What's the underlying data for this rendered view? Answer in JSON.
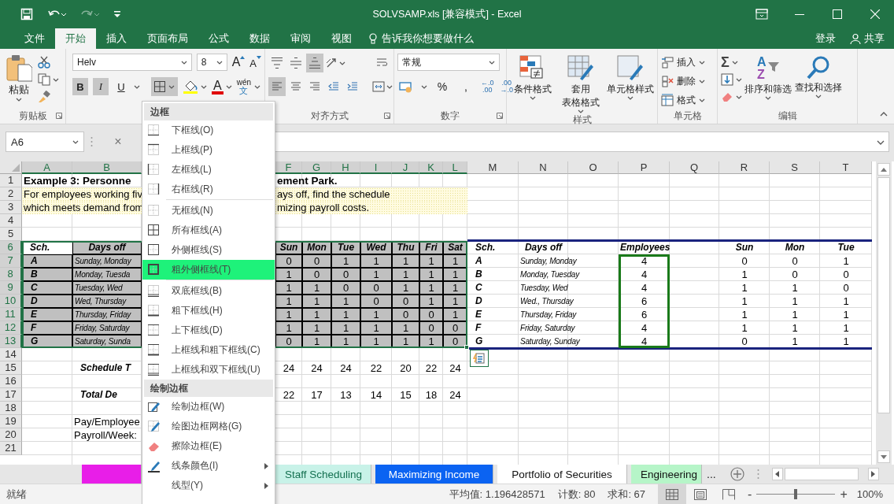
{
  "window": {
    "title": "SOLVSAMP.xls  [兼容模式] - Excel",
    "redo_disabled": true
  },
  "menu_tabs": [
    {
      "label": "文件",
      "selected": false
    },
    {
      "label": "开始",
      "selected": true
    },
    {
      "label": "插入",
      "selected": false
    },
    {
      "label": "页面布局",
      "selected": false
    },
    {
      "label": "公式",
      "selected": false
    },
    {
      "label": "数据",
      "selected": false
    },
    {
      "label": "审阅",
      "selected": false
    },
    {
      "label": "视图",
      "selected": false
    }
  ],
  "tell_me": "告诉我你想要做什么",
  "sign_in": "登录",
  "share": "共享",
  "ribbon": {
    "clipboard": {
      "paste": "粘贴",
      "label": "剪贴板"
    },
    "font": {
      "name": "Helv",
      "size": "8",
      "grow": "A",
      "shrink": "A",
      "buttons": [
        {
          "text": "B",
          "on": true
        },
        {
          "text": "I",
          "on": true
        },
        {
          "text": "U",
          "on": false
        }
      ],
      "borders_on": true,
      "font_color": "A",
      "phonetic": {
        "top": "wén",
        "bottom": "文"
      }
    },
    "alignment": {
      "label": "对齐方式",
      "top_row": [
        {
          "on": false
        },
        {
          "on": false
        },
        {
          "on": true
        },
        {
          "on": false
        }
      ],
      "bottom_row": [
        {
          "on": true
        },
        {
          "on": false
        },
        {
          "on": false
        },
        {
          "on": false
        },
        {
          "on": false
        }
      ]
    },
    "number": {
      "format": "常规",
      "percent": "%",
      "comma": ",",
      "more_decimals": {
        "top": "←.0",
        "bottom": ".00"
      },
      "fewer_decimals": {
        "top": ".00",
        "bottom": "→.0"
      },
      "label": "数字"
    },
    "styles": {
      "buttons": [
        {
          "lines": [
            "条件格式"
          ]
        },
        {
          "lines": [
            "套用",
            "表格格式"
          ]
        },
        {
          "lines": [
            "单元格样式"
          ]
        }
      ],
      "label": "样式"
    },
    "cells": {
      "buttons": [
        "插入",
        "删除",
        "格式"
      ],
      "label": "单元格"
    },
    "editing": {
      "sum": "Σ",
      "sort_letters": {
        "top": "A",
        "bottom": "Z"
      },
      "buttons": [
        "排序和筛选",
        "查找和选择"
      ],
      "label": "编辑"
    }
  },
  "formula_bar": {
    "name_box": "A6",
    "cancel": "×"
  },
  "sheet": {
    "columns": [
      {
        "letter": "A",
        "selected": true
      },
      {
        "letter": "B",
        "selected": true
      },
      {
        "letter": "F",
        "selected": true
      },
      {
        "letter": "G",
        "selected": true
      },
      {
        "letter": "H",
        "selected": true
      },
      {
        "letter": "I",
        "selected": true
      },
      {
        "letter": "J",
        "selected": true
      },
      {
        "letter": "K",
        "selected": true
      },
      {
        "letter": "L",
        "selected": true
      },
      {
        "letter": "M",
        "selected": false
      },
      {
        "letter": "N",
        "selected": false
      },
      {
        "letter": "O",
        "selected": false
      },
      {
        "letter": "P",
        "selected": false
      },
      {
        "letter": "Q",
        "selected": false
      },
      {
        "letter": "R",
        "selected": false
      },
      {
        "letter": "S",
        "selected": false
      },
      {
        "letter": "T",
        "selected": false
      }
    ],
    "rows": [
      {
        "number": "1",
        "selected": false,
        "highlighted": false,
        "cells": [
          {
            "text": "Example 3:  Personne",
            "kind": "title",
            "shaded": false
          },
          null,
          {
            "text": "ement Park.",
            "kind": "title",
            "shaded": false
          },
          null,
          null,
          null,
          null,
          null,
          null,
          null,
          null,
          null,
          null,
          null,
          null,
          null,
          null
        ]
      },
      {
        "number": "2",
        "selected": false,
        "highlighted": true,
        "cells": [
          {
            "text": "For employees working fiv",
            "kind": "text",
            "shaded": false
          },
          null,
          {
            "text": "ays off, find the schedule",
            "kind": "text",
            "shaded": false
          },
          null,
          null,
          null,
          null,
          null,
          null,
          null,
          null,
          null,
          null,
          null,
          null,
          null,
          null
        ]
      },
      {
        "number": "3",
        "selected": false,
        "highlighted": true,
        "cells": [
          {
            "text": "which meets demand from",
            "kind": "text",
            "shaded": false
          },
          null,
          {
            "text": "mizing payroll costs.",
            "kind": "text",
            "shaded": false
          },
          null,
          null,
          null,
          null,
          null,
          null,
          null,
          null,
          null,
          null,
          null,
          null,
          null,
          null
        ]
      },
      {
        "number": "4",
        "selected": false,
        "highlighted": false,
        "cells": []
      },
      {
        "number": "5",
        "selected": false,
        "highlighted": false,
        "cells": []
      },
      {
        "number": "6",
        "selected": true,
        "highlighted": false,
        "cells": [
          {
            "text": "Sch.",
            "kind": "letter",
            "shaded": false
          },
          {
            "text": "Days off",
            "kind": "head",
            "shaded": true
          },
          {
            "text": "Sun",
            "kind": "head",
            "shaded": true
          },
          {
            "text": "Mon",
            "kind": "head",
            "shaded": true
          },
          {
            "text": "Tue",
            "kind": "head",
            "shaded": true
          },
          {
            "text": "Wed",
            "kind": "head",
            "shaded": true
          },
          {
            "text": "Thu",
            "kind": "head",
            "shaded": true
          },
          {
            "text": "Fri",
            "kind": "head",
            "shaded": true
          },
          {
            "text": "Sat",
            "kind": "head",
            "shaded": true
          },
          {
            "text": "Sch.",
            "kind": "letter",
            "shaded": false
          },
          {
            "text": "Days off",
            "kind": "head",
            "shaded": false
          },
          null,
          {
            "text": "Employees",
            "kind": "head",
            "shaded": false
          },
          null,
          {
            "text": "Sun",
            "kind": "head",
            "shaded": false
          },
          {
            "text": "Mon",
            "kind": "head",
            "shaded": false
          },
          {
            "text": "Tue",
            "kind": "head",
            "shaded": false
          }
        ]
      },
      {
        "number": "7",
        "selected": true,
        "highlighted": false,
        "cells": [
          {
            "text": "A",
            "kind": "letter",
            "shaded": true
          },
          {
            "text": "Sunday, Monday",
            "kind": "days",
            "shaded": true
          },
          {
            "text": "0",
            "kind": "num",
            "shaded": true
          },
          {
            "text": "0",
            "kind": "num",
            "shaded": true
          },
          {
            "text": "1",
            "kind": "num",
            "shaded": true
          },
          {
            "text": "1",
            "kind": "num",
            "shaded": true
          },
          {
            "text": "1",
            "kind": "num",
            "shaded": true
          },
          {
            "text": "1",
            "kind": "num",
            "shaded": true
          },
          {
            "text": "1",
            "kind": "num",
            "shaded": true
          },
          {
            "text": "A",
            "kind": "letter",
            "shaded": false
          },
          {
            "text": "Sunday, Monday",
            "kind": "days",
            "shaded": false
          },
          null,
          {
            "text": "4",
            "kind": "num",
            "shaded": false
          },
          null,
          {
            "text": "0",
            "kind": "num",
            "shaded": false
          },
          {
            "text": "0",
            "kind": "num",
            "shaded": false
          },
          {
            "text": "1",
            "kind": "num",
            "shaded": false
          }
        ]
      },
      {
        "number": "8",
        "selected": true,
        "highlighted": false,
        "cells": [
          {
            "text": "B",
            "kind": "letter",
            "shaded": true
          },
          {
            "text": "Monday, Tuesda",
            "kind": "days",
            "shaded": true
          },
          {
            "text": "1",
            "kind": "num",
            "shaded": true
          },
          {
            "text": "0",
            "kind": "num",
            "shaded": true
          },
          {
            "text": "0",
            "kind": "num",
            "shaded": true
          },
          {
            "text": "1",
            "kind": "num",
            "shaded": true
          },
          {
            "text": "1",
            "kind": "num",
            "shaded": true
          },
          {
            "text": "1",
            "kind": "num",
            "shaded": true
          },
          {
            "text": "1",
            "kind": "num",
            "shaded": true
          },
          {
            "text": "B",
            "kind": "letter",
            "shaded": false
          },
          {
            "text": "Monday, Tuesday",
            "kind": "days",
            "shaded": false
          },
          null,
          {
            "text": "4",
            "kind": "num",
            "shaded": false
          },
          null,
          {
            "text": "1",
            "kind": "num",
            "shaded": false
          },
          {
            "text": "0",
            "kind": "num",
            "shaded": false
          },
          {
            "text": "0",
            "kind": "num",
            "shaded": false
          }
        ]
      },
      {
        "number": "9",
        "selected": true,
        "highlighted": false,
        "cells": [
          {
            "text": "C",
            "kind": "letter",
            "shaded": true
          },
          {
            "text": "Tuesday, Wed",
            "kind": "days",
            "shaded": true
          },
          {
            "text": "1",
            "kind": "num",
            "shaded": true
          },
          {
            "text": "1",
            "kind": "num",
            "shaded": true
          },
          {
            "text": "0",
            "kind": "num",
            "shaded": true
          },
          {
            "text": "0",
            "kind": "num",
            "shaded": true
          },
          {
            "text": "1",
            "kind": "num",
            "shaded": true
          },
          {
            "text": "1",
            "kind": "num",
            "shaded": true
          },
          {
            "text": "1",
            "kind": "num",
            "shaded": true
          },
          {
            "text": "C",
            "kind": "letter",
            "shaded": false
          },
          {
            "text": "Tuesday, Wed",
            "kind": "days",
            "shaded": false
          },
          null,
          {
            "text": "4",
            "kind": "num",
            "shaded": false
          },
          null,
          {
            "text": "1",
            "kind": "num",
            "shaded": false
          },
          {
            "text": "1",
            "kind": "num",
            "shaded": false
          },
          {
            "text": "0",
            "kind": "num",
            "shaded": false
          }
        ]
      },
      {
        "number": "10",
        "selected": true,
        "highlighted": false,
        "cells": [
          {
            "text": "D",
            "kind": "letter",
            "shaded": true
          },
          {
            "text": "Wed, Thursday",
            "kind": "days",
            "shaded": true
          },
          {
            "text": "1",
            "kind": "num",
            "shaded": true
          },
          {
            "text": "1",
            "kind": "num",
            "shaded": true
          },
          {
            "text": "1",
            "kind": "num",
            "shaded": true
          },
          {
            "text": "0",
            "kind": "num",
            "shaded": true
          },
          {
            "text": "0",
            "kind": "num",
            "shaded": true
          },
          {
            "text": "1",
            "kind": "num",
            "shaded": true
          },
          {
            "text": "1",
            "kind": "num",
            "shaded": true
          },
          {
            "text": "D",
            "kind": "letter",
            "shaded": false
          },
          {
            "text": "Wed., Thursday",
            "kind": "days",
            "shaded": false
          },
          null,
          {
            "text": "6",
            "kind": "num",
            "shaded": false
          },
          null,
          {
            "text": "1",
            "kind": "num",
            "shaded": false
          },
          {
            "text": "1",
            "kind": "num",
            "shaded": false
          },
          {
            "text": "1",
            "kind": "num",
            "shaded": false
          }
        ]
      },
      {
        "number": "11",
        "selected": true,
        "highlighted": false,
        "cells": [
          {
            "text": "E",
            "kind": "letter",
            "shaded": true
          },
          {
            "text": "Thursday, Friday",
            "kind": "days",
            "shaded": true
          },
          {
            "text": "1",
            "kind": "num",
            "shaded": true
          },
          {
            "text": "1",
            "kind": "num",
            "shaded": true
          },
          {
            "text": "1",
            "kind": "num",
            "shaded": true
          },
          {
            "text": "1",
            "kind": "num",
            "shaded": true
          },
          {
            "text": "0",
            "kind": "num",
            "shaded": true
          },
          {
            "text": "0",
            "kind": "num",
            "shaded": true
          },
          {
            "text": "1",
            "kind": "num",
            "shaded": true
          },
          {
            "text": "E",
            "kind": "letter",
            "shaded": false
          },
          {
            "text": "Thursday, Friday",
            "kind": "days",
            "shaded": false
          },
          null,
          {
            "text": "6",
            "kind": "num",
            "shaded": false
          },
          null,
          {
            "text": "1",
            "kind": "num",
            "shaded": false
          },
          {
            "text": "1",
            "kind": "num",
            "shaded": false
          },
          {
            "text": "1",
            "kind": "num",
            "shaded": false
          }
        ]
      },
      {
        "number": "12",
        "selected": true,
        "highlighted": false,
        "cells": [
          {
            "text": "F",
            "kind": "letter",
            "shaded": true
          },
          {
            "text": "Friday, Saturday",
            "kind": "days",
            "shaded": true
          },
          {
            "text": "1",
            "kind": "num",
            "shaded": true
          },
          {
            "text": "1",
            "kind": "num",
            "shaded": true
          },
          {
            "text": "1",
            "kind": "num",
            "shaded": true
          },
          {
            "text": "1",
            "kind": "num",
            "shaded": true
          },
          {
            "text": "1",
            "kind": "num",
            "shaded": true
          },
          {
            "text": "0",
            "kind": "num",
            "shaded": true
          },
          {
            "text": "0",
            "kind": "num",
            "shaded": true
          },
          {
            "text": "F",
            "kind": "letter",
            "shaded": false
          },
          {
            "text": "Friday, Saturday",
            "kind": "days",
            "shaded": false
          },
          null,
          {
            "text": "4",
            "kind": "num",
            "shaded": false
          },
          null,
          {
            "text": "1",
            "kind": "num",
            "shaded": false
          },
          {
            "text": "1",
            "kind": "num",
            "shaded": false
          },
          {
            "text": "1",
            "kind": "num",
            "shaded": false
          }
        ]
      },
      {
        "number": "13",
        "selected": true,
        "highlighted": false,
        "cells": [
          {
            "text": "G",
            "kind": "letter",
            "shaded": true
          },
          {
            "text": "Saturday, Sunda",
            "kind": "days",
            "shaded": true
          },
          {
            "text": "0",
            "kind": "num",
            "shaded": true
          },
          {
            "text": "1",
            "kind": "num",
            "shaded": true
          },
          {
            "text": "1",
            "kind": "num",
            "shaded": true
          },
          {
            "text": "1",
            "kind": "num",
            "shaded": true
          },
          {
            "text": "1",
            "kind": "num",
            "shaded": true
          },
          {
            "text": "1",
            "kind": "num",
            "shaded": true
          },
          {
            "text": "0",
            "kind": "num",
            "shaded": true
          },
          {
            "text": "G",
            "kind": "letter",
            "shaded": false
          },
          {
            "text": "Saturday, Sunday",
            "kind": "days",
            "shaded": false
          },
          null,
          {
            "text": "4",
            "kind": "num",
            "shaded": false
          },
          null,
          {
            "text": "0",
            "kind": "num",
            "shaded": false
          },
          {
            "text": "1",
            "kind": "num",
            "shaded": false
          },
          {
            "text": "1",
            "kind": "num",
            "shaded": false
          }
        ]
      },
      {
        "number": "14",
        "selected": false,
        "highlighted": false,
        "cells": []
      },
      {
        "number": "15",
        "selected": false,
        "highlighted": false,
        "cells": [
          null,
          {
            "text": "Schedule T",
            "kind": "label",
            "shaded": false
          },
          {
            "text": "24",
            "kind": "num",
            "shaded": false
          },
          {
            "text": "24",
            "kind": "num",
            "shaded": false
          },
          {
            "text": "24",
            "kind": "num",
            "shaded": false
          },
          {
            "text": "22",
            "kind": "num",
            "shaded": false
          },
          {
            "text": "20",
            "kind": "num",
            "shaded": false
          },
          {
            "text": "22",
            "kind": "num",
            "shaded": false
          },
          {
            "text": "24",
            "kind": "num",
            "shaded": false
          }
        ]
      },
      {
        "number": "16",
        "selected": false,
        "highlighted": false,
        "cells": []
      },
      {
        "number": "17",
        "selected": false,
        "highlighted": false,
        "cells": [
          null,
          {
            "text": "Total De",
            "kind": "label",
            "shaded": false
          },
          {
            "text": "22",
            "kind": "num",
            "shaded": false
          },
          {
            "text": "17",
            "kind": "num",
            "shaded": false
          },
          {
            "text": "13",
            "kind": "num",
            "shaded": false
          },
          {
            "text": "14",
            "kind": "num",
            "shaded": false
          },
          {
            "text": "15",
            "kind": "num",
            "shaded": false
          },
          {
            "text": "18",
            "kind": "num",
            "shaded": false
          },
          {
            "text": "24",
            "kind": "num",
            "shaded": false
          }
        ]
      },
      {
        "number": "18",
        "selected": false,
        "highlighted": false,
        "cells": []
      },
      {
        "number": "19",
        "selected": false,
        "highlighted": false,
        "cells": [
          null,
          {
            "text": "Pay/Employee",
            "kind": "text",
            "shaded": false
          }
        ]
      },
      {
        "number": "20",
        "selected": false,
        "highlighted": false,
        "cells": [
          null,
          {
            "text": "Payroll/Week:",
            "kind": "text",
            "shaded": false
          }
        ]
      },
      {
        "number": "21",
        "selected": false,
        "highlighted": false,
        "cells": []
      }
    ]
  },
  "border_menu": {
    "sections": [
      {
        "header": "边框",
        "items": [
          {
            "label": "下框线(O)",
            "selected": false,
            "submenu": false
          },
          {
            "label": "上框线(P)",
            "selected": false,
            "submenu": false
          },
          {
            "label": "左框线(L)",
            "selected": false,
            "submenu": false
          },
          {
            "label": "右框线(R)",
            "selected": false,
            "submenu": false
          }
        ]
      },
      {
        "items": [
          {
            "label": "无框线(N)",
            "selected": false,
            "submenu": false
          },
          {
            "label": "所有框线(A)",
            "selected": false,
            "submenu": false
          },
          {
            "label": "外侧框线(S)",
            "selected": false,
            "submenu": false
          },
          {
            "label": "粗外侧框线(T)",
            "selected": true,
            "submenu": false
          }
        ]
      },
      {
        "items": [
          {
            "label": "双底框线(B)",
            "selected": false,
            "submenu": false
          },
          {
            "label": "粗下框线(H)",
            "selected": false,
            "submenu": false
          },
          {
            "label": "上下框线(D)",
            "selected": false,
            "submenu": false
          },
          {
            "label": "上框线和粗下框线(C)",
            "selected": false,
            "submenu": false
          },
          {
            "label": "上框线和双下框线(U)",
            "selected": false,
            "submenu": false
          }
        ]
      },
      {
        "header": "绘制边框",
        "items": [
          {
            "label": "绘制边框(W)",
            "selected": false,
            "submenu": false
          },
          {
            "label": "绘图边框网格(G)",
            "selected": false,
            "submenu": false
          },
          {
            "label": "擦除边框(E)",
            "selected": false,
            "submenu": false
          },
          {
            "label": "线条颜色(I)",
            "selected": false,
            "submenu": true
          },
          {
            "label": "线型(Y)",
            "selected": false,
            "submenu": true
          }
        ]
      }
    ]
  },
  "sheet_tabs": [
    {
      "color": "#e81ee8",
      "selected": false
    },
    {
      "label": "Staff Scheduling",
      "color": "#c8f2e8",
      "selected": false
    },
    {
      "label": "Maximizing Income",
      "color": "#0b63f2",
      "selected": false
    },
    {
      "label": "Portfolio of Securities",
      "color": "#ffffff",
      "selected": false
    },
    {
      "label": "Engineering",
      "color": "#b6f5c8",
      "selected": false
    }
  ],
  "more_tabs": "...",
  "status_bar": {
    "ready": "就绪",
    "average": "平均值: 1.196428571",
    "count": "计数: 80",
    "sum": "求和: 67",
    "views": [
      {
        "selected": true
      },
      {
        "selected": false
      },
      {
        "selected": false
      }
    ],
    "zoom_minus": "-",
    "zoom_plus": "+",
    "zoom": {
      "level": 0.5
    },
    "zoom_text": "100%"
  }
}
